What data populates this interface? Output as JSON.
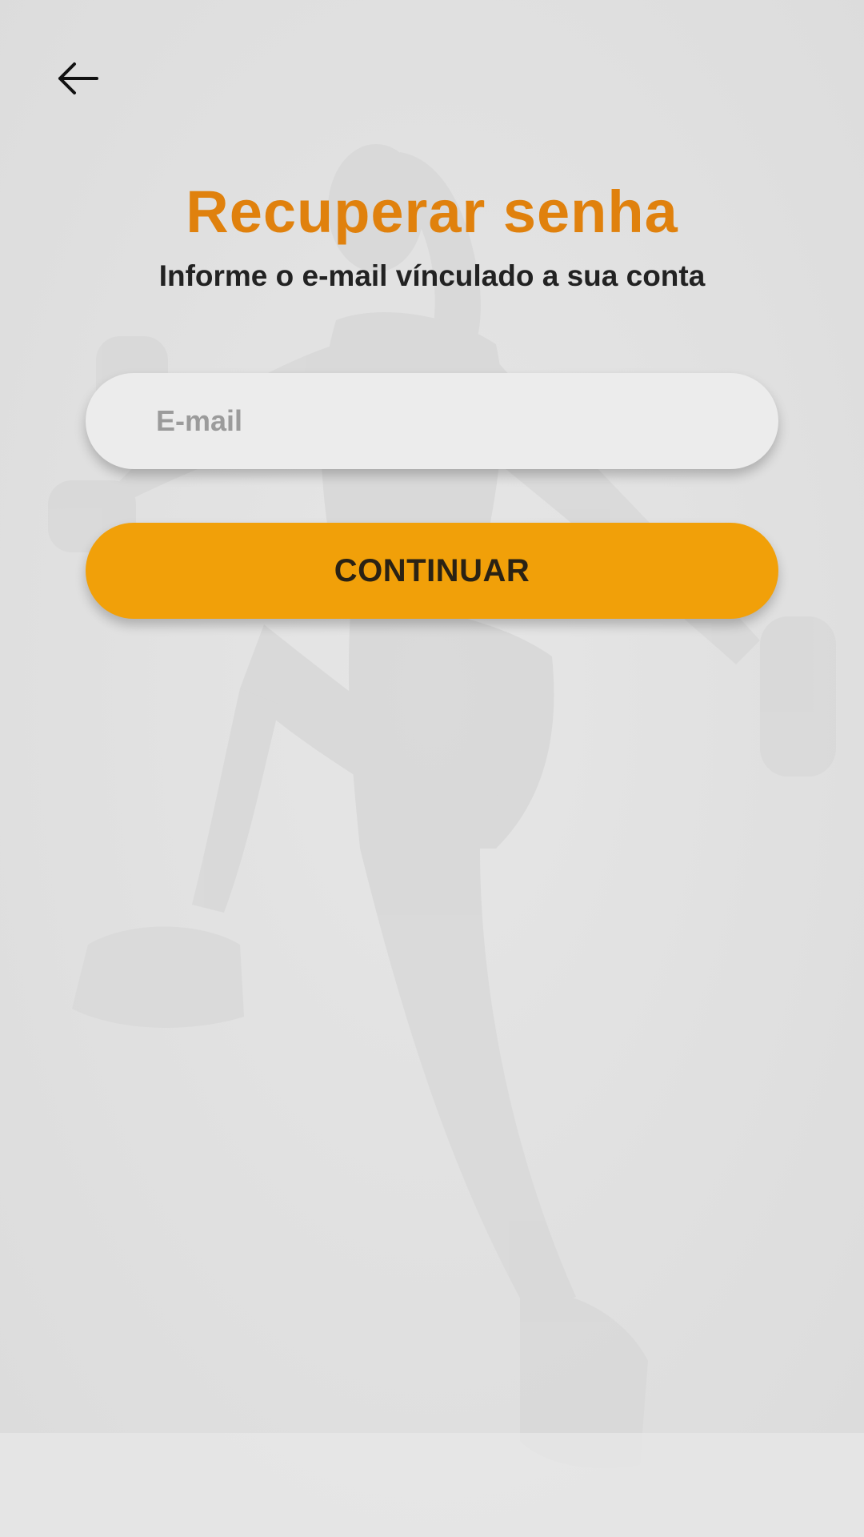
{
  "header": {
    "back_icon": "arrow-left-icon"
  },
  "content": {
    "title": "Recuperar senha",
    "subtitle": "Informe o e-mail vínculado a sua conta"
  },
  "form": {
    "email_placeholder": "E-mail",
    "email_value": "",
    "continue_label": "CONTINUAR"
  },
  "colors": {
    "accent": "#f1a009",
    "title": "#e0810d",
    "background": "#e2e2e2",
    "text": "#222222"
  },
  "background": {
    "image": "athlete-with-dumbbells-photo"
  }
}
